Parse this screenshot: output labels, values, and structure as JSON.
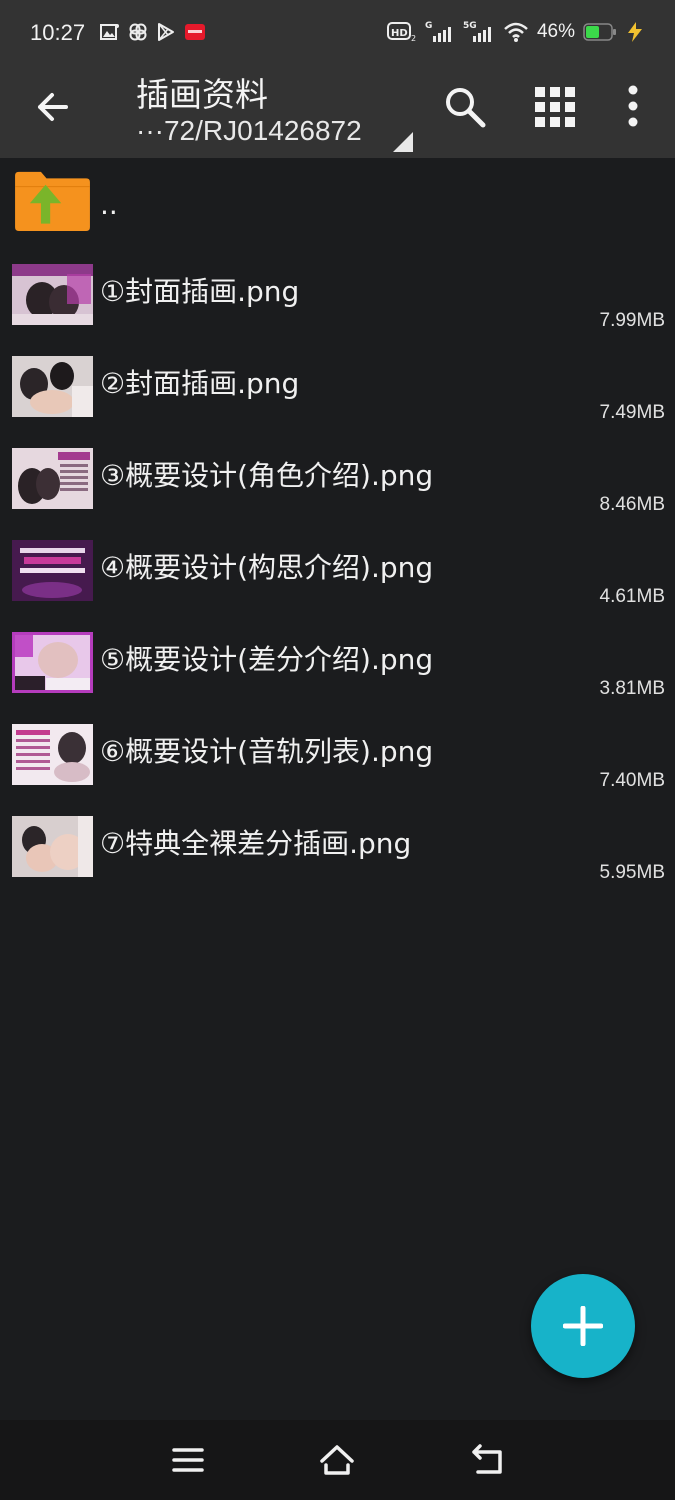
{
  "status_bar": {
    "time": "10:27",
    "battery_percent": "46%",
    "icons": [
      "gallery-notification-icon",
      "app-notification-icon",
      "play-store-icon",
      "red-app-icon",
      "hd-icon",
      "signal-g-icon",
      "signal-5g-icon",
      "wifi-icon",
      "battery-icon",
      "charging-icon"
    ]
  },
  "toolbar": {
    "title": "插画资料",
    "path": "···72/RJ01426872",
    "icons": [
      "back-arrow-icon",
      "search-icon",
      "grid-view-icon",
      "more-vert-icon"
    ]
  },
  "list": {
    "parent_label": "..",
    "files": [
      {
        "name": "①封面插画.png",
        "size": "7.99MB"
      },
      {
        "name": "②封面插画.png",
        "size": "7.49MB"
      },
      {
        "name": "③概要设计(角色介绍).png",
        "size": "8.46MB"
      },
      {
        "name": "④概要设计(构思介绍).png",
        "size": "4.61MB"
      },
      {
        "name": "⑤概要设计(差分介绍).png",
        "size": "3.81MB"
      },
      {
        "name": "⑥概要设计(音轨列表).png",
        "size": "7.40MB"
      },
      {
        "name": "⑦特典全裸差分插画.png",
        "size": "5.95MB"
      }
    ]
  },
  "fab": {
    "icon": "plus-icon",
    "color": "#17b3c9"
  },
  "nav": {
    "icons": [
      "menu-icon",
      "home-icon",
      "back-icon"
    ]
  },
  "colors": {
    "toolbar_bg": "#333333",
    "list_bg": "#1b1c1e",
    "accent": "#17b3c9",
    "folder": "#f5921e",
    "folder_arrow": "#7ab52a"
  }
}
